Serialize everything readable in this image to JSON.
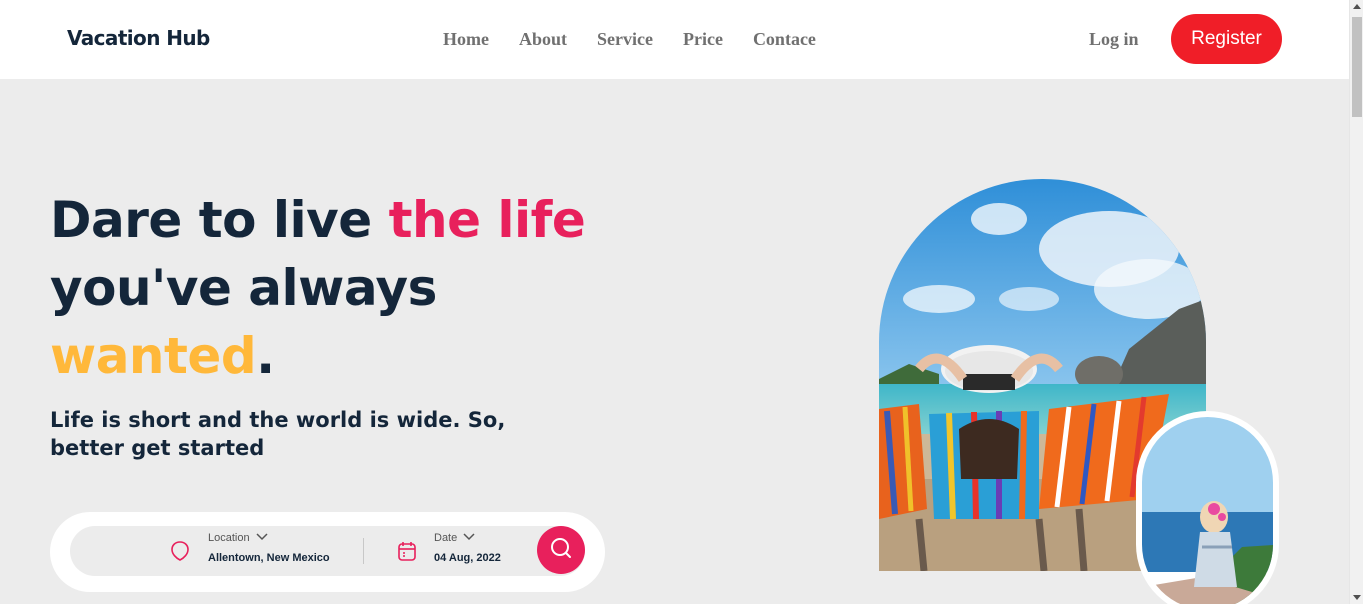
{
  "header": {
    "logo": "Vacation Hub",
    "nav": [
      "Home",
      "About",
      "Service",
      "Price",
      "Contace"
    ],
    "login_label": "Log in",
    "register_label": "Register"
  },
  "hero": {
    "headline_part1": "Dare to live ",
    "headline_pink": "the life",
    "headline_part2": "you've always",
    "headline_yellow": "wanted",
    "headline_period": ".",
    "subline": "Life is short and the world is wide. So, better get started"
  },
  "search": {
    "location_label": "Location",
    "location_value": "Allentown, New Mexico",
    "date_label": "Date",
    "date_value": "04 Aug, 2022"
  },
  "colors": {
    "accent_pink": "#e8205c",
    "accent_yellow": "#ffb83a",
    "register_red": "#f01e28",
    "navy": "#14263a"
  },
  "icons": {
    "location": "map-pin-icon",
    "calendar": "calendar-icon",
    "search": "search-icon",
    "chevron": "chevron-down-icon"
  }
}
